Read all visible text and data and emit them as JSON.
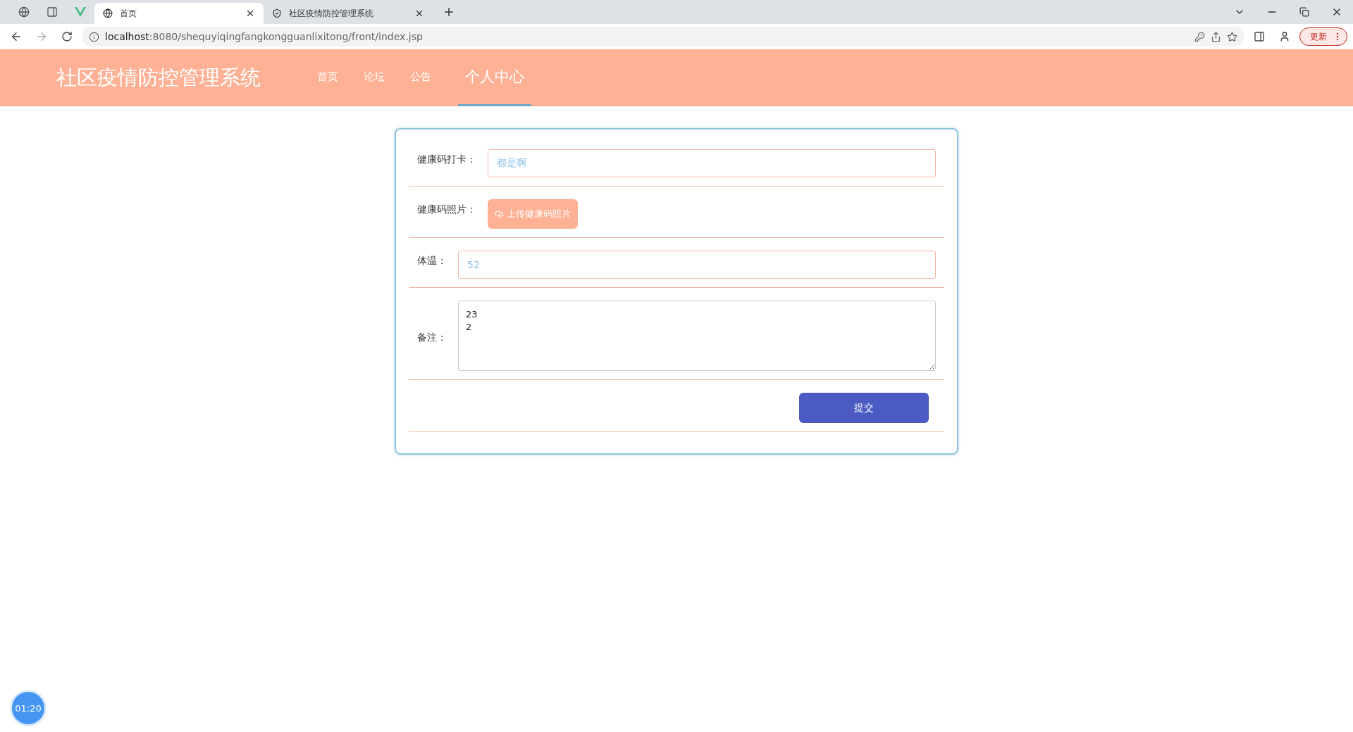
{
  "browser": {
    "tabs": [
      {
        "title": "首页",
        "selected": true
      },
      {
        "title": "社区疫情防控管理系统",
        "selected": false
      }
    ],
    "url_host": "localhost",
    "url_rest": ":8080/shequyiqingfangkongguanlixitong/front/index.jsp",
    "update_button": "更新"
  },
  "header": {
    "title": "社区疫情防控管理系统",
    "nav": [
      {
        "label": "首页",
        "selected": false
      },
      {
        "label": "论坛",
        "selected": false
      },
      {
        "label": "公告",
        "selected": false
      },
      {
        "label": "个人中心",
        "selected": true
      }
    ]
  },
  "form": {
    "rows": [
      {
        "kind": "input",
        "label": "健康码打卡：",
        "value": "都是啊"
      },
      {
        "kind": "upload",
        "label": "健康码照片：",
        "button": "上传健康码照片"
      },
      {
        "kind": "input",
        "label": "体温：",
        "value": "52"
      },
      {
        "kind": "textarea",
        "label": "备注：",
        "value": "23\n2"
      }
    ],
    "submit": "提交"
  },
  "timer": "01:20"
}
